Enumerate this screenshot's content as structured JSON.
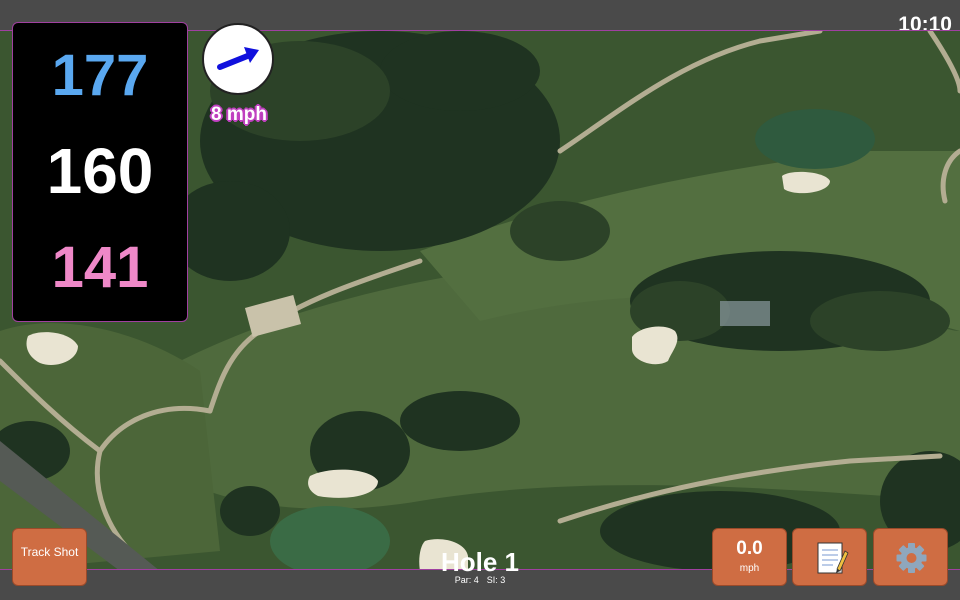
{
  "status": {
    "time": "10:10"
  },
  "distances": {
    "back": "177",
    "middle": "160",
    "front": "141"
  },
  "wind": {
    "speed_label": "8 mph",
    "direction_icon": "arrow-icon"
  },
  "hole": {
    "title": "Hole 1",
    "par": "Par: 4",
    "si": "SI: 3"
  },
  "buttons": {
    "track_shot": "Track Shot",
    "wind_value": "0.0",
    "wind_unit": "mph",
    "notes_icon": "notepad-icon",
    "settings_icon": "gear-icon"
  },
  "colors": {
    "back_distance": "#5aa8f0",
    "front_distance": "#ef88c8",
    "button": "#cf6d43",
    "accent": "#a040a0"
  }
}
